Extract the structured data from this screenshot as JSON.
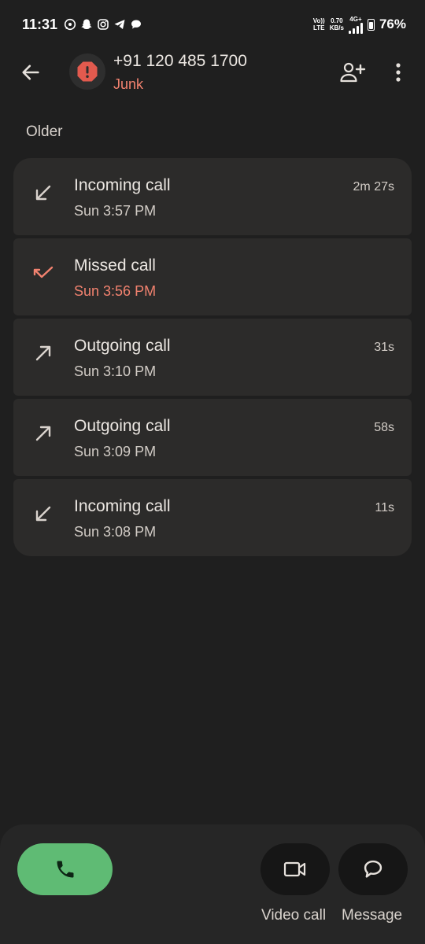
{
  "status_bar": {
    "time": "11:31",
    "volte": [
      "Vo))",
      "LTE"
    ],
    "speed": [
      "0.70",
      "KB/s"
    ],
    "network": "4G+",
    "battery": "76%",
    "app_icons": [
      "whatsapp-icon",
      "snapchat-icon",
      "instagram-icon",
      "telegram-icon",
      "chat-bubble-icon"
    ]
  },
  "header": {
    "number": "+91 120 485 1700",
    "label": "Junk"
  },
  "section_label": "Older",
  "calls": [
    {
      "type": "Incoming call",
      "time": "Sun 3:57 PM",
      "duration": "2m 27s",
      "direction": "incoming"
    },
    {
      "type": "Missed call",
      "time": "Sun 3:56 PM",
      "duration": "",
      "direction": "missed"
    },
    {
      "type": "Outgoing call",
      "time": "Sun 3:10 PM",
      "duration": "31s",
      "direction": "outgoing"
    },
    {
      "type": "Outgoing call",
      "time": "Sun 3:09 PM",
      "duration": "58s",
      "direction": "outgoing"
    },
    {
      "type": "Incoming call",
      "time": "Sun 3:08 PM",
      "duration": "11s",
      "direction": "incoming"
    }
  ],
  "actions": {
    "video_call": "Video call",
    "message": "Message"
  },
  "colors": {
    "background": "#1f1f1f",
    "card": "#2c2b2a",
    "junk_red": "#f2826f",
    "call_green": "#5fbb74",
    "alert_red": "#e25a4e"
  }
}
